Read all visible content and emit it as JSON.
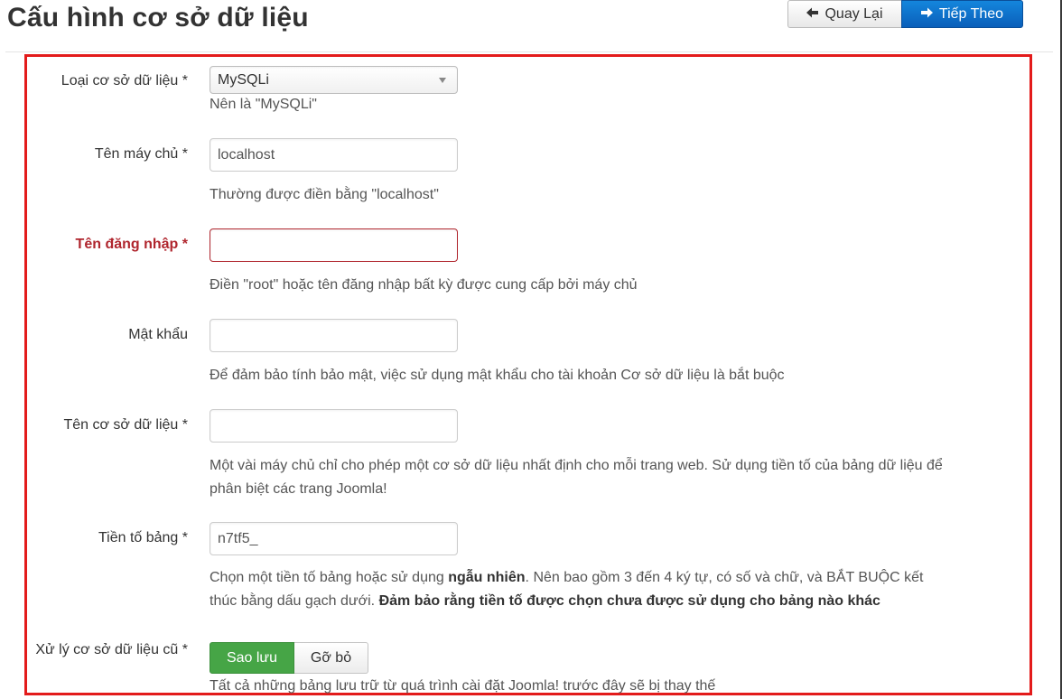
{
  "header": {
    "title": "Cấu hình cơ sở dữ liệu",
    "back_label": "Quay Lại",
    "next_label": "Tiếp Theo"
  },
  "form": {
    "db_type": {
      "label": "Loại cơ sở dữ liệu *",
      "value": "MySQLi",
      "help": "Nên là \"MySQLi\""
    },
    "host": {
      "label": "Tên máy chủ *",
      "value": "localhost",
      "help": "Thường được điền bằng \"localhost\""
    },
    "username": {
      "label": "Tên đăng nhập *",
      "value": "",
      "help": "Điền \"root\" hoặc tên đăng nhập bất kỳ được cung cấp bởi máy chủ"
    },
    "password": {
      "label": "Mật khẩu",
      "value": "",
      "help": "Để đảm bảo tính bảo mật, việc sử dụng mật khẩu cho tài khoản Cơ sở dữ liệu là bắt buộc"
    },
    "db_name": {
      "label": "Tên cơ sở dữ liệu *",
      "value": "",
      "help_line1": "Một vài máy chủ chỉ cho phép một cơ sở dữ liệu nhất định cho mỗi trang web. Sử dụng tiền tố của bảng dữ liệu để",
      "help_line2": "phân biệt các trang Joomla!"
    },
    "prefix": {
      "label": "Tiền tố bảng *",
      "value": "n7tf5_",
      "help_part1": "Chọn một tiền tố bảng hoặc sử dụng ",
      "help_bold1": "ngẫu nhiên",
      "help_part2": ". Nên bao gồm 3 đến 4 ký tự, có số và chữ, và BẮT BUỘC kết",
      "help_part3": "thúc bằng dấu gạch dưới. ",
      "help_bold2": "Đảm bảo rằng tiền tố được chọn chưa được sử dụng cho bảng nào khác"
    },
    "old_db": {
      "label": "Xử lý cơ sở dữ liệu cũ *",
      "option_backup": "Sao lưu",
      "option_remove": "Gỡ bỏ",
      "help": "Tất cả những bảng lưu trữ từ quá trình cài đặt Joomla! trước đây sẽ bị thay thế"
    }
  },
  "colors": {
    "frame": "#e31b1b",
    "primary": "#0a5fba",
    "success": "#46a546",
    "error": "#b0262e"
  },
  "icons": {
    "back": "arrow-left-icon",
    "next": "arrow-right-icon"
  }
}
